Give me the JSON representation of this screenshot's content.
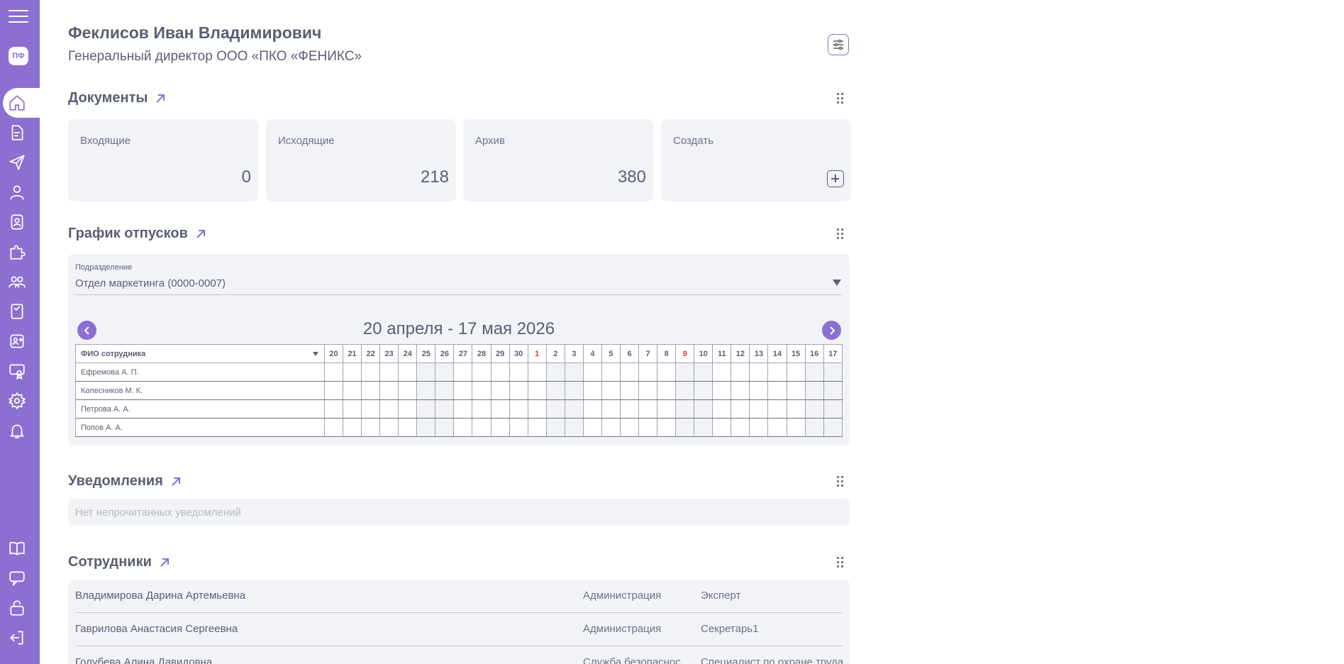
{
  "sidebar": {
    "logo": "ПФ",
    "icons": [
      "home-icon",
      "document-icon",
      "send-icon",
      "user-icon",
      "badge-icon",
      "puzzle-icon",
      "team-icon",
      "book-icon",
      "add-user-icon",
      "certificate-icon",
      "gear-icon",
      "bell-icon"
    ],
    "bottom_icons": [
      "guide-icon",
      "chat-icon",
      "lock-icon",
      "logout-icon"
    ]
  },
  "user": {
    "name": "Феклисов Иван Владимирович",
    "role": "Генеральный директор ООО «ПКО «ФЕНИКС»"
  },
  "documents": {
    "title": "Документы",
    "cards": [
      {
        "label": "Входящие",
        "count": "0"
      },
      {
        "label": "Исходящие",
        "count": "218"
      },
      {
        "label": "Архив",
        "count": "380"
      },
      {
        "label": "Создать",
        "count": ""
      }
    ]
  },
  "vacations": {
    "title": "График отпусков",
    "dept_label": "Подразделение",
    "dept_value": "Отдел маркетинга (0000-0007)",
    "period": "20 апреля - 17 мая 2026",
    "name_header": "ФИО сотрудника",
    "days": [
      "20",
      "21",
      "22",
      "23",
      "24",
      "25",
      "26",
      "27",
      "28",
      "29",
      "30",
      "1",
      "2",
      "3",
      "4",
      "5",
      "6",
      "7",
      "8",
      "9",
      "10",
      "11",
      "12",
      "13",
      "14",
      "15",
      "16",
      "17"
    ],
    "weekend_idx": [
      5,
      6,
      12,
      13,
      19,
      20,
      26,
      27
    ],
    "red_idx": [
      11,
      19
    ],
    "employees": [
      "Ефремова А. П.",
      "Колесников М. К.",
      "Петрова А. А.",
      "Попов А. А."
    ]
  },
  "notifications": {
    "title": "Уведомления",
    "empty": "Нет непрочитанных уведомлений"
  },
  "employees": {
    "title": "Сотрудники",
    "rows": [
      {
        "name": "Владимирова Дарина Артемьевна",
        "dept": "Администрация",
        "position": "Эксперт"
      },
      {
        "name": "Гаврилова Анастасия Сергеевна",
        "dept": "Администрация",
        "position": "Секретарь1"
      },
      {
        "name": "Голубева Алина Давидовна",
        "dept": "Служба безопаснос",
        "position": "Специалист по охране труда"
      }
    ]
  },
  "colors": {
    "accent": "#8c6fd1",
    "text": "#5a5e74",
    "panel": "#f2f3f7",
    "holiday": "#e03535"
  }
}
